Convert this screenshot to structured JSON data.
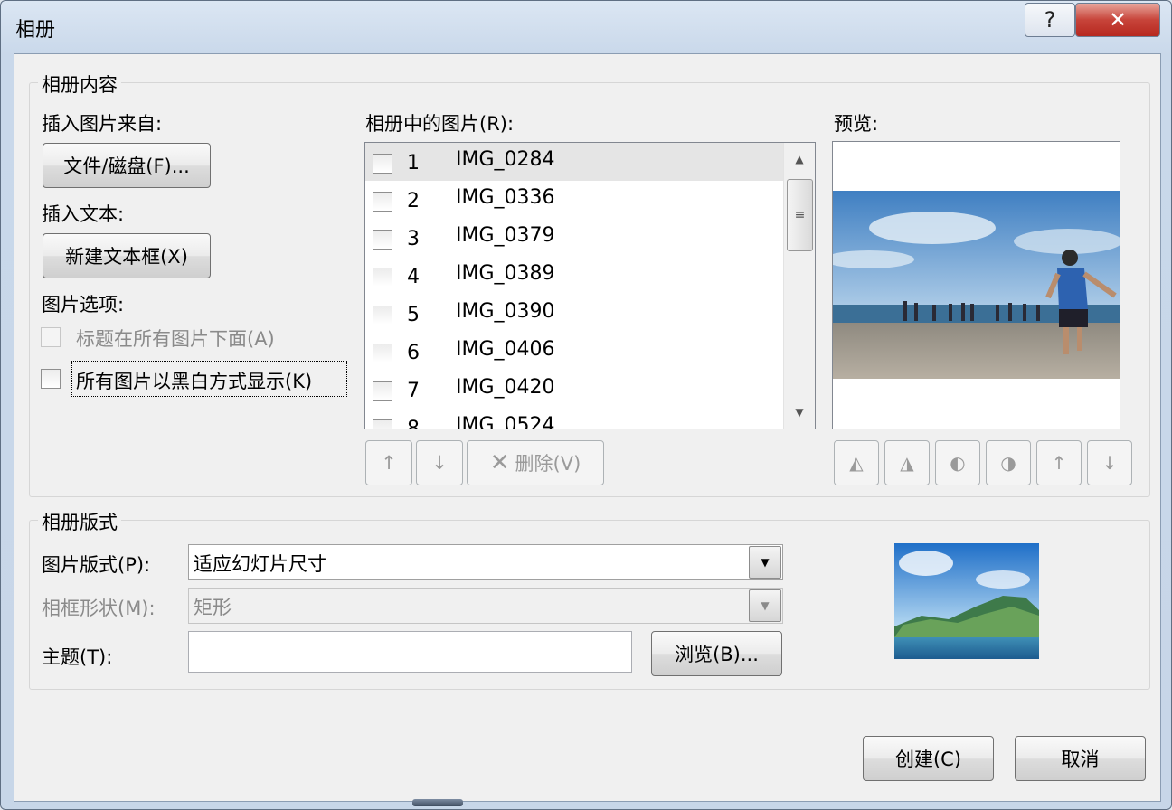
{
  "window": {
    "title": "相册",
    "help_label": "?",
    "close_label": "✕"
  },
  "content_group": {
    "title": "相册内容",
    "insert_picture_label": "插入图片来自:",
    "file_disk_button": "文件/磁盘(F)...",
    "insert_text_label": "插入文本:",
    "new_textbox_button": "新建文本框(X)",
    "picture_options_label": "图片选项:",
    "caption_option": "标题在所有图片下面(A)",
    "bw_option": "所有图片以黑白方式显示(K)",
    "list_label": "相册中的图片(R):",
    "pictures": [
      {
        "num": "1",
        "name": "IMG_0284"
      },
      {
        "num": "2",
        "name": "IMG_0336"
      },
      {
        "num": "3",
        "name": "IMG_0379"
      },
      {
        "num": "4",
        "name": "IMG_0389"
      },
      {
        "num": "5",
        "name": "IMG_0390"
      },
      {
        "num": "6",
        "name": "IMG_0406"
      },
      {
        "num": "7",
        "name": "IMG_0420"
      },
      {
        "num": "8",
        "name": "IMG_0524"
      }
    ],
    "move_up": "↑",
    "move_down": "↓",
    "delete_button": "删除(V)",
    "preview_label": "预览:"
  },
  "layout_group": {
    "title": "相册版式",
    "picture_layout_label": "图片版式(P):",
    "picture_layout_value": "适应幻灯片尺寸",
    "frame_shape_label": "相框形状(M):",
    "frame_shape_value": "矩形",
    "theme_label": "主题(T):",
    "theme_value": "",
    "browse_button": "浏览(B)..."
  },
  "footer": {
    "create_button": "创建(C)",
    "cancel_button": "取消"
  }
}
